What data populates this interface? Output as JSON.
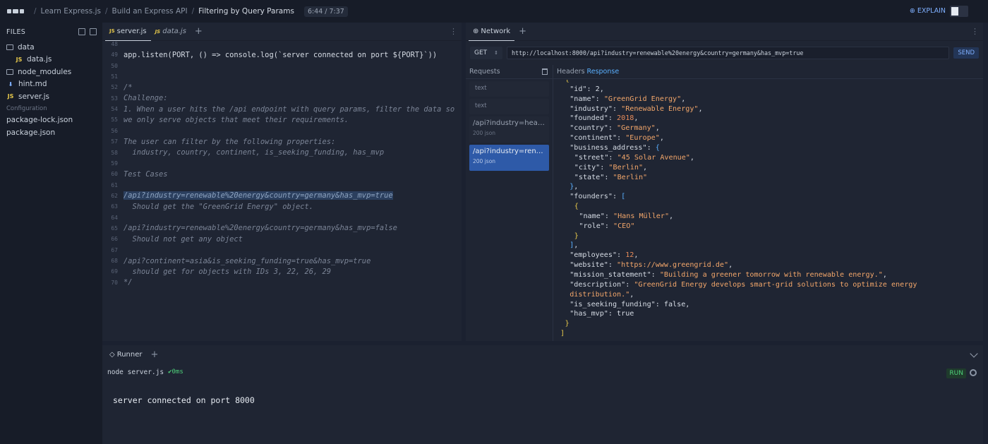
{
  "breadcrumb": [
    "Learn Express.js",
    "Build an Express API",
    "Filtering by Query Params"
  ],
  "timer": "6:44 / 7:37",
  "explain_label": "EXPLAIN",
  "sidebar": {
    "title": "FILES",
    "files": [
      {
        "name": "data",
        "type": "folder",
        "indent": 0
      },
      {
        "name": "data.js",
        "type": "js",
        "indent": 1
      },
      {
        "name": "node_modules",
        "type": "folder",
        "indent": 0
      },
      {
        "name": "hint.md",
        "type": "md",
        "indent": 0
      },
      {
        "name": "server.js",
        "type": "js",
        "indent": 0
      }
    ],
    "config_label": "Configuration",
    "config_files": [
      {
        "name": "package-lock.json",
        "type": "json"
      },
      {
        "name": "package.json",
        "type": "json"
      }
    ]
  },
  "editor": {
    "tabs": [
      {
        "label": "server.js",
        "active": true
      },
      {
        "label": "data.js",
        "active": false
      }
    ],
    "lines": [
      {
        "n": "48",
        "text": ""
      },
      {
        "n": "49",
        "text": "app.listen(PORT, () => console.log(`server connected on port ${PORT}`))",
        "kind": "code"
      },
      {
        "n": "50",
        "text": ""
      },
      {
        "n": "51",
        "text": ""
      },
      {
        "n": "52",
        "text": "/*",
        "kind": "comment"
      },
      {
        "n": "53",
        "text": "Challenge:",
        "kind": "comment"
      },
      {
        "n": "54",
        "text": "1. When a user hits the /api endpoint with query params, filter the data so",
        "kind": "comment"
      },
      {
        "n": "55",
        "text": "we only serve objects that meet their requirements.",
        "kind": "comment"
      },
      {
        "n": "56",
        "text": ""
      },
      {
        "n": "57",
        "text": "The user can filter by the following properties:",
        "kind": "comment"
      },
      {
        "n": "58",
        "text": "  industry, country, continent, is_seeking_funding, has_mvp",
        "kind": "comment"
      },
      {
        "n": "59",
        "text": ""
      },
      {
        "n": "60",
        "text": "Test Cases",
        "kind": "comment"
      },
      {
        "n": "61",
        "text": ""
      },
      {
        "n": "62",
        "text": "/api?industry=renewable%20energy&country=germany&has_mvp=true",
        "kind": "highlight"
      },
      {
        "n": "63",
        "text": "  Should get the \"GreenGrid Energy\" object.",
        "kind": "comment"
      },
      {
        "n": "64",
        "text": ""
      },
      {
        "n": "65",
        "text": "/api?industry=renewable%20energy&country=germany&has_mvp=false",
        "kind": "comment"
      },
      {
        "n": "66",
        "text": "  Should not get any object",
        "kind": "comment"
      },
      {
        "n": "67",
        "text": ""
      },
      {
        "n": "68",
        "text": "/api?continent=asia&is_seeking_funding=true&has_mvp=true",
        "kind": "comment"
      },
      {
        "n": "69",
        "text": "  should get for objects with IDs 3, 22, 26, 29",
        "kind": "comment"
      },
      {
        "n": "70",
        "text": "*/",
        "kind": "comment"
      }
    ]
  },
  "network": {
    "tab_label": "Network",
    "method": "GET",
    "url": "http://localhost:8000/api?industry=renewable%20energy&country=germany&has_mvp=true",
    "send_label": "SEND",
    "requests_title": "Requests",
    "requests": [
      {
        "path": "text",
        "status": ""
      },
      {
        "path": "text",
        "status": ""
      },
      {
        "path": "/api?industry=health...",
        "status": "200 json"
      },
      {
        "path": "/api?industry=renew...",
        "status": "200 json",
        "selected": true
      }
    ],
    "headers_label": "Headers",
    "response_label": "Response",
    "response_lines": [
      {
        "i": 2,
        "parts": [
          [
            "p",
            "{"
          ]
        ]
      },
      {
        "i": 4,
        "parts": [
          [
            "k",
            "\"id\": 2,"
          ]
        ]
      },
      {
        "i": 4,
        "parts": [
          [
            "k",
            "\"name\": "
          ],
          [
            "s",
            "\"GreenGrid Energy\""
          ],
          [
            "k",
            ","
          ]
        ]
      },
      {
        "i": 4,
        "parts": [
          [
            "k",
            "\"industry\": "
          ],
          [
            "s",
            "\"Renewable Energy\""
          ],
          [
            "k",
            ","
          ]
        ]
      },
      {
        "i": 4,
        "parts": [
          [
            "k",
            "\"founded\": "
          ],
          [
            "n",
            "2018"
          ],
          [
            "k",
            ","
          ]
        ]
      },
      {
        "i": 4,
        "parts": [
          [
            "k",
            "\"country\": "
          ],
          [
            "s",
            "\"Germany\""
          ],
          [
            "k",
            ","
          ]
        ]
      },
      {
        "i": 4,
        "parts": [
          [
            "k",
            "\"continent\": "
          ],
          [
            "s",
            "\"Europe\""
          ],
          [
            "k",
            ","
          ]
        ]
      },
      {
        "i": 4,
        "parts": [
          [
            "k",
            "\"business_address\": "
          ],
          [
            "p2",
            "{"
          ]
        ]
      },
      {
        "i": 6,
        "parts": [
          [
            "k",
            "\"street\": "
          ],
          [
            "s",
            "\"45 Solar Avenue\""
          ],
          [
            "k",
            ","
          ]
        ]
      },
      {
        "i": 6,
        "parts": [
          [
            "k",
            "\"city\": "
          ],
          [
            "s",
            "\"Berlin\""
          ],
          [
            "k",
            ","
          ]
        ]
      },
      {
        "i": 6,
        "parts": [
          [
            "k",
            "\"state\": "
          ],
          [
            "s",
            "\"Berlin\""
          ]
        ]
      },
      {
        "i": 4,
        "parts": [
          [
            "p2",
            "}"
          ],
          [
            "k",
            ","
          ]
        ]
      },
      {
        "i": 4,
        "parts": [
          [
            "k",
            "\"founders\": "
          ],
          [
            "p2",
            "["
          ]
        ]
      },
      {
        "i": 6,
        "parts": [
          [
            "p",
            "{"
          ]
        ]
      },
      {
        "i": 8,
        "parts": [
          [
            "k",
            "\"name\": "
          ],
          [
            "s",
            "\"Hans Müller\""
          ],
          [
            "k",
            ","
          ]
        ]
      },
      {
        "i": 8,
        "parts": [
          [
            "k",
            "\"role\": "
          ],
          [
            "s",
            "\"CEO\""
          ]
        ]
      },
      {
        "i": 6,
        "parts": [
          [
            "p",
            "}"
          ]
        ]
      },
      {
        "i": 4,
        "parts": [
          [
            "p2",
            "]"
          ],
          [
            "k",
            ","
          ]
        ]
      },
      {
        "i": 4,
        "parts": [
          [
            "k",
            "\"employees\": "
          ],
          [
            "n",
            "12"
          ],
          [
            "k",
            ","
          ]
        ]
      },
      {
        "i": 4,
        "parts": [
          [
            "k",
            "\"website\": "
          ],
          [
            "s",
            "\"https://www.greengrid.de\""
          ],
          [
            "k",
            ","
          ]
        ]
      },
      {
        "i": 4,
        "parts": [
          [
            "k",
            "\"mission_statement\": "
          ],
          [
            "s",
            "\"Building a greener tomorrow with renewable energy.\""
          ],
          [
            "k",
            ","
          ]
        ]
      },
      {
        "i": 4,
        "parts": [
          [
            "k",
            "\"description\": "
          ],
          [
            "s",
            "\"GreenGrid Energy develops smart-grid solutions to optimize energy"
          ]
        ]
      },
      {
        "i": 4,
        "parts": [
          [
            "s",
            "distribution.\""
          ],
          [
            "k",
            ","
          ]
        ]
      },
      {
        "i": 4,
        "parts": [
          [
            "k",
            "\"is_seeking_funding\": "
          ],
          [
            "b",
            "false"
          ],
          [
            "k",
            ","
          ]
        ]
      },
      {
        "i": 4,
        "parts": [
          [
            "k",
            "\"has_mvp\": "
          ],
          [
            "b",
            "true"
          ]
        ]
      },
      {
        "i": 2,
        "parts": [
          [
            "p",
            "}"
          ]
        ]
      },
      {
        "i": 0,
        "parts": [
          [
            "p",
            "]"
          ]
        ]
      }
    ]
  },
  "runner": {
    "tab_label": "Runner",
    "command": "node server.js",
    "timing": "0ms",
    "run_label": "RUN",
    "output": "server connected on port 8000"
  }
}
